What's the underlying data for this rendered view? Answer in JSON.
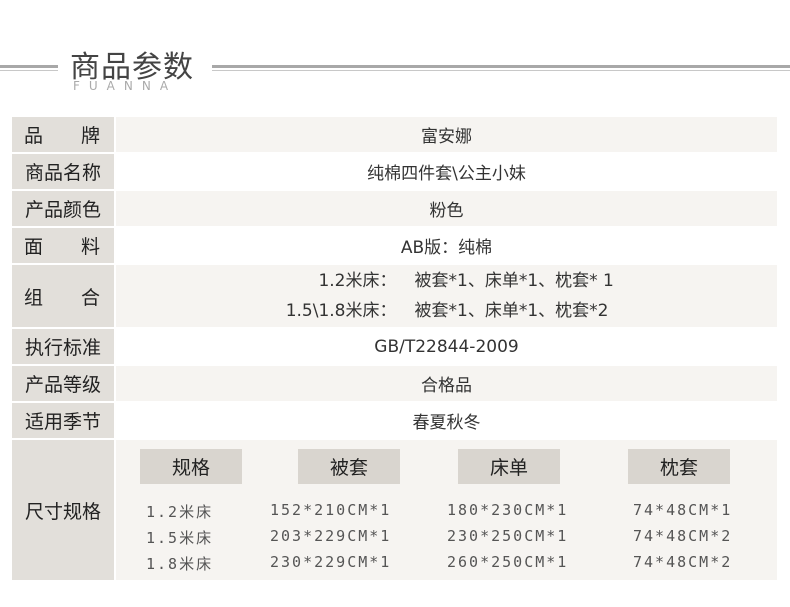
{
  "header": {
    "title": "商品参数",
    "subtitle": "FUANNA"
  },
  "rows": [
    {
      "label_a": "品",
      "label_b": "牌",
      "value": "富安娜"
    },
    {
      "label": "商品名称",
      "value": "纯棉四件套\\公主小妹"
    },
    {
      "label": "产品颜色",
      "value": "粉色"
    },
    {
      "label_a": "面",
      "label_b": "料",
      "value": "AB版：纯棉"
    },
    {
      "label_a": "组",
      "label_b": "合",
      "lines": [
        {
          "key": "1.2米床：",
          "val": "被套*1、床单*1、枕套* 1"
        },
        {
          "key": "1.5\\1.8米床：",
          "val": "被套*1、床单*1、枕套*2"
        }
      ]
    },
    {
      "label": "执行标准",
      "value": "GB/T22844-2009"
    },
    {
      "label": "产品等级",
      "value": "合格品"
    },
    {
      "label": "适用季节",
      "value": "春夏秋冬"
    }
  ],
  "size": {
    "label": "尺寸规格",
    "headers": [
      "规格",
      "被套",
      "床单",
      "枕套"
    ],
    "rows": [
      [
        "1.2米床",
        "152*210CM*1",
        "180*230CM*1",
        "74*48CM*1"
      ],
      [
        "1.5米床",
        "203*229CM*1",
        "230*250CM*1",
        "74*48CM*2"
      ],
      [
        "1.8米床",
        "230*229CM*1",
        "260*250CM*1",
        "74*48CM*2"
      ]
    ]
  }
}
